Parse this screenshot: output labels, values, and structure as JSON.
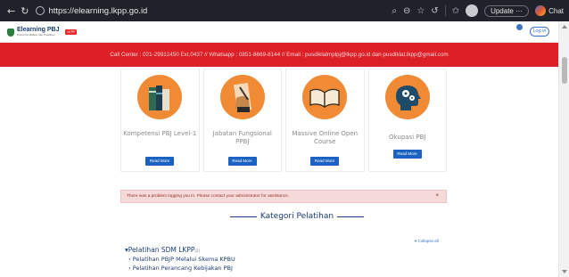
{
  "browser": {
    "url": "https://elearning.lkpp.go.id",
    "update_label": "Update",
    "chat_label": "Chat"
  },
  "header": {
    "logo_title": "Elearning PBJ",
    "logo_sub": "Pusat Pendidikan dan Pelatihan",
    "logo_tag": "LKPP",
    "login_label": "Log in"
  },
  "banner": {
    "text": "Call Center : 021-29912450 Ext.0437 // Whatsapp : 0851-8669-8144 // Email : pusdiklatmplpj@lkpp.go.id dan pusdiklat.lkpp@gmail.com"
  },
  "cards": [
    {
      "title": "Kompetensi PBJ Level-1",
      "button": "Read More"
    },
    {
      "title": "Jabatan Fungsional PPBJ",
      "button": "Read More"
    },
    {
      "title": "Massive Online Open Course",
      "button": "Read More"
    },
    {
      "title": "Okupasi PBJ",
      "button": "Read More"
    }
  ],
  "alert": {
    "text": "There was a problem logging you in. Please contact your administrator for assistance.",
    "close": "×"
  },
  "section": {
    "heading": "Kategori Pelatihan",
    "collapse_all": "Collapse all"
  },
  "categories": {
    "root_label": "Pelatihan SDM LKPP",
    "root_count": "(2)",
    "children": [
      "Pelatihan PBJP Melalui Skema KPBU",
      "Pelatihan Perancang Kebijakan PBJ"
    ]
  },
  "colors": {
    "banner": "#dd1f26",
    "accent_orange": "#f08a34",
    "button_blue": "#1b62c2",
    "heading_navy": "#1b3b7a"
  }
}
